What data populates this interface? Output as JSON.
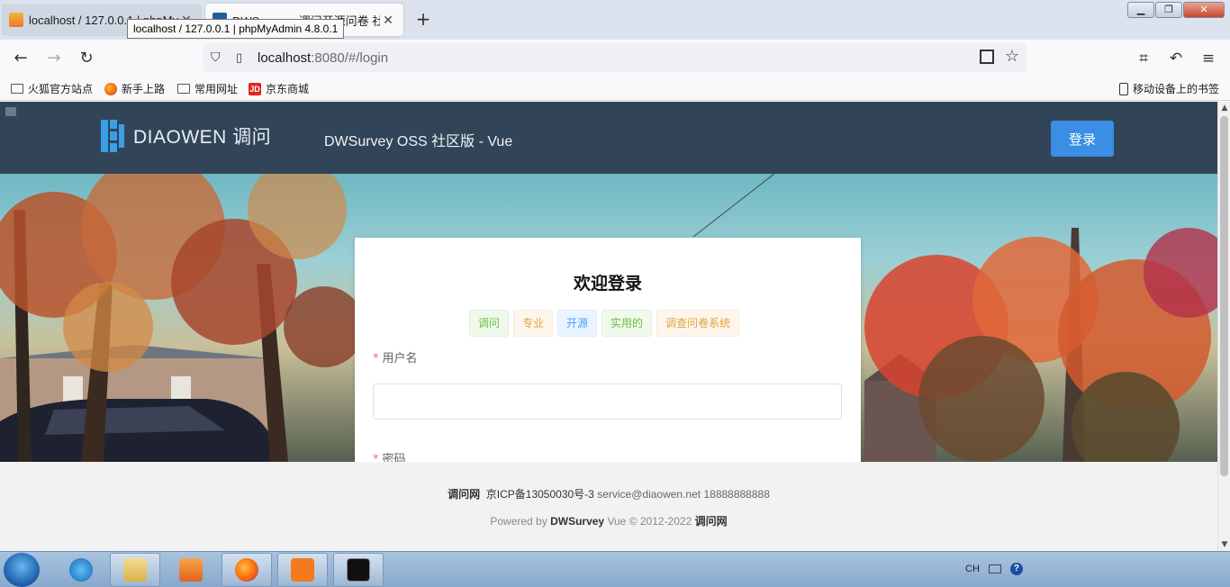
{
  "browser": {
    "tabs": [
      {
        "title": "localhost / 127.0.0.1 | phpMyAdmin 4.8.0.1",
        "active": false
      },
      {
        "title": "DWSurvey - 调问开源问卷 社区版",
        "active": true
      }
    ],
    "tooltip": "localhost / 127.0.0.1 | phpMyAdmin 4.8.0.1",
    "address": {
      "host": "localhost",
      "rest": ":8080/#/login"
    },
    "bookmarks": [
      {
        "label": "火狐官方站点",
        "icon": "folder-icon"
      },
      {
        "label": "新手上路",
        "icon": "firefox-icon"
      },
      {
        "label": "常用网址",
        "icon": "folder-icon"
      },
      {
        "label": "京东商城",
        "icon": "jd-icon"
      }
    ],
    "mobile_bookmarks": "移动设备上的书签"
  },
  "app": {
    "logo_text": "DIAOWEN 调问",
    "subtitle": "DWSurvey OSS 社区版 - Vue",
    "login_button": "登录",
    "colors": {
      "header": "#324457",
      "accent": "#3a8ee6"
    }
  },
  "login_card": {
    "title": "欢迎登录",
    "tags": [
      {
        "label": "调问",
        "style": "green"
      },
      {
        "label": "专业",
        "style": "orange"
      },
      {
        "label": "开源",
        "style": "blue"
      },
      {
        "label": "实用的",
        "style": "green"
      },
      {
        "label": "调查问卷系统",
        "style": "orange"
      }
    ],
    "username_label": "用户名",
    "username_value": "",
    "password_label": "密码"
  },
  "footer": {
    "brand": "调问网",
    "icp": "京ICP备13050030号-3",
    "email": "service@diaowen.net",
    "phone": "18888888888",
    "powered_prefix": "Powered by",
    "powered_product": "DWSurvey",
    "powered_suffix": "Vue © 2012-2022",
    "powered_brand": "调问网"
  },
  "taskbar": {
    "lang": "CH"
  }
}
